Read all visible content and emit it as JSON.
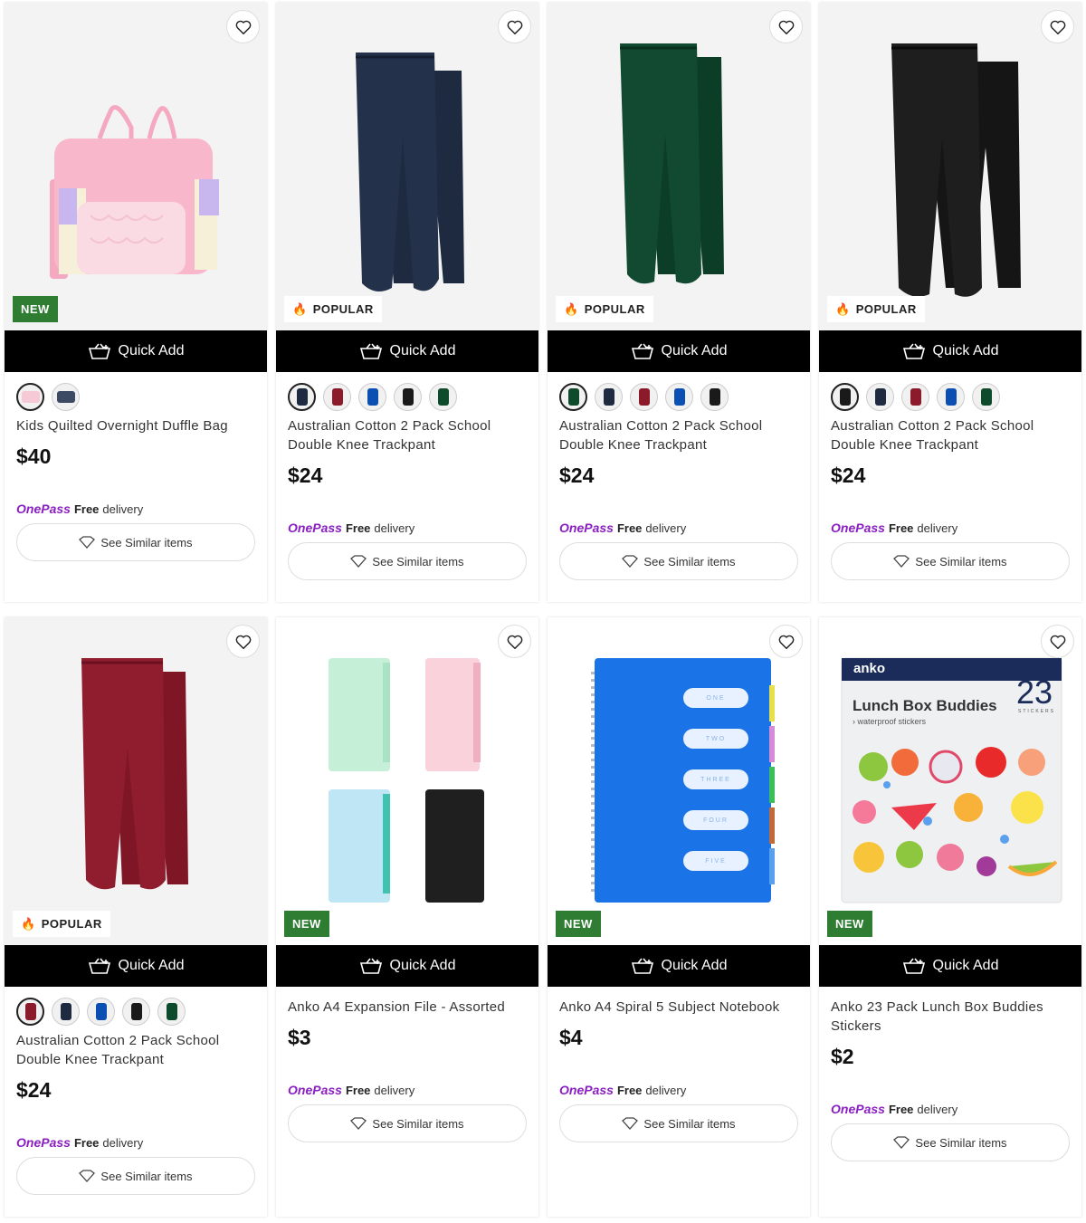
{
  "quick_add_label": "Quick Add",
  "see_similar_label": "See Similar items",
  "onepass_label": "OnePass",
  "free_label": "Free",
  "delivery_label": "delivery",
  "colors": {
    "badge_new": "#2e7d32",
    "onepass": "#8a1ec2",
    "quick_add_bg": "#000000"
  },
  "products": [
    {
      "name": "Kids Quilted Overnight Duffle Bag",
      "price": "$40",
      "badge": "NEW"
    },
    {
      "name": "Australian Cotton 2 Pack School Double Knee Trackpant",
      "price": "$24",
      "badge": "POPULAR"
    },
    {
      "name": "Australian Cotton 2 Pack School Double Knee Trackpant",
      "price": "$24",
      "badge": "POPULAR"
    },
    {
      "name": "Australian Cotton 2 Pack School Double Knee Trackpant",
      "price": "$24",
      "badge": "POPULAR"
    },
    {
      "name": "Australian Cotton 2 Pack School Double Knee Trackpant",
      "price": "$24",
      "badge": "POPULAR"
    },
    {
      "name": "Anko A4 Expansion File - Assorted",
      "price": "$3",
      "badge": "NEW"
    },
    {
      "name": "Anko A4 Spiral 5 Subject Notebook",
      "price": "$4",
      "badge": "NEW"
    },
    {
      "name": "Anko 23 Pack Lunch Box Buddies Stickers",
      "price": "$2",
      "badge": "NEW"
    }
  ],
  "notebook_tabs": [
    "ONE",
    "TWO",
    "THREE",
    "FOUR",
    "FIVE"
  ],
  "sticker_pack": {
    "brand": "anko",
    "title": "Lunch Box Buddies",
    "subtitle": "› waterproof stickers",
    "count": "23",
    "count_label": "STICKERS"
  }
}
